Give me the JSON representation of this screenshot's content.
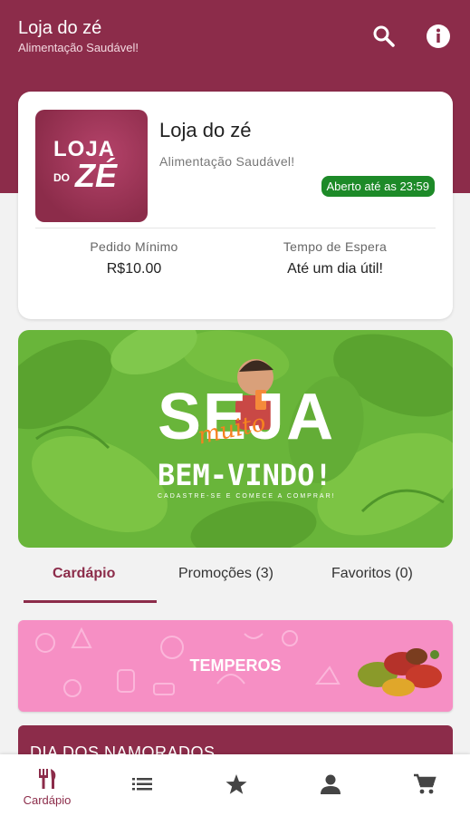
{
  "header": {
    "title": "Loja do zé",
    "subtitle": "Alimentação Saudável!",
    "search_icon": "search-icon",
    "info_icon": "info-icon"
  },
  "store": {
    "logo_text": {
      "line1": "LOJA",
      "line2": "DO",
      "line3": "ZÉ"
    },
    "name": "Loja do zé",
    "description": "Alimentação Saudável!",
    "status": "Aberto até as 23:59",
    "min_order_label": "Pedido Mínimo",
    "min_order_value": "R$10.00",
    "wait_label": "Tempo de Espera",
    "wait_value": "Até um dia útil!"
  },
  "banner": {
    "line1": "SEJA",
    "line2": "muito",
    "line3": "BEM-VINDO!",
    "line4": "CADASTRE-SE E COMECE A COMPRAR!"
  },
  "tabs": [
    {
      "label": "Cardápio",
      "active": true
    },
    {
      "label": "Promoções (3)",
      "active": false
    },
    {
      "label": "Favoritos (0)",
      "active": false
    }
  ],
  "categories": [
    {
      "title": "TEMPEROS",
      "color": "#f68fc4"
    },
    {
      "title": "DIA DOS NAMORADOS",
      "color": "#8c2c4a"
    }
  ],
  "bottom_nav": [
    {
      "icon": "cutlery-icon",
      "label": "Cardápio",
      "active": true
    },
    {
      "icon": "list-icon",
      "label": "",
      "active": false
    },
    {
      "icon": "star-icon",
      "label": "",
      "active": false
    },
    {
      "icon": "person-icon",
      "label": "",
      "active": false
    },
    {
      "icon": "cart-icon",
      "label": "",
      "active": false
    }
  ],
  "colors": {
    "brand": "#8c2c4a",
    "open": "#1d8a28",
    "banner_green": "#69b53a"
  }
}
